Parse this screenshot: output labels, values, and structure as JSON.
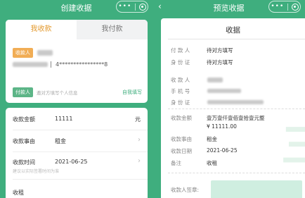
{
  "left": {
    "nav_title": "创建收据",
    "tabs": [
      "我收款",
      "我付款"
    ],
    "payee_tag": "收款人",
    "account_masked": "4****************8",
    "payer_tag": "付款人",
    "payer_hint": "邀对方填写个人信息",
    "payer_link": "自我填写",
    "fields": {
      "amount_label": "收款金额",
      "amount_value": "11111",
      "amount_unit": "元",
      "reason_label": "收款事由",
      "reason_value": "租金",
      "time_label": "收款时间",
      "time_value": "2021-06-25",
      "time_hint": "建议以实际签署时间为准",
      "note_value": "收租"
    }
  },
  "right": {
    "nav_title": "预览收据",
    "doc_title": "收据",
    "payer_label": "付 款 人",
    "payer_value": "待对方填写",
    "id_label": "身 份 证",
    "id_value": "待对方填写",
    "payee_label": "收 款 人",
    "phone_label": "手 机 号",
    "id2_label": "身 份 证",
    "amount_label": "收款金额",
    "amount_upper": "壹万壹仟壹佰壹拾壹元整",
    "amount_num": "¥ 11111.00",
    "reason_label": "收款事由",
    "reason_value": "租金",
    "date_label": "收款日期",
    "date_value": "2021-06-25",
    "note_label": "备注",
    "note_value": "收租",
    "sign_label": "收款人签章:"
  },
  "capsule": {
    "menu": "•••"
  }
}
